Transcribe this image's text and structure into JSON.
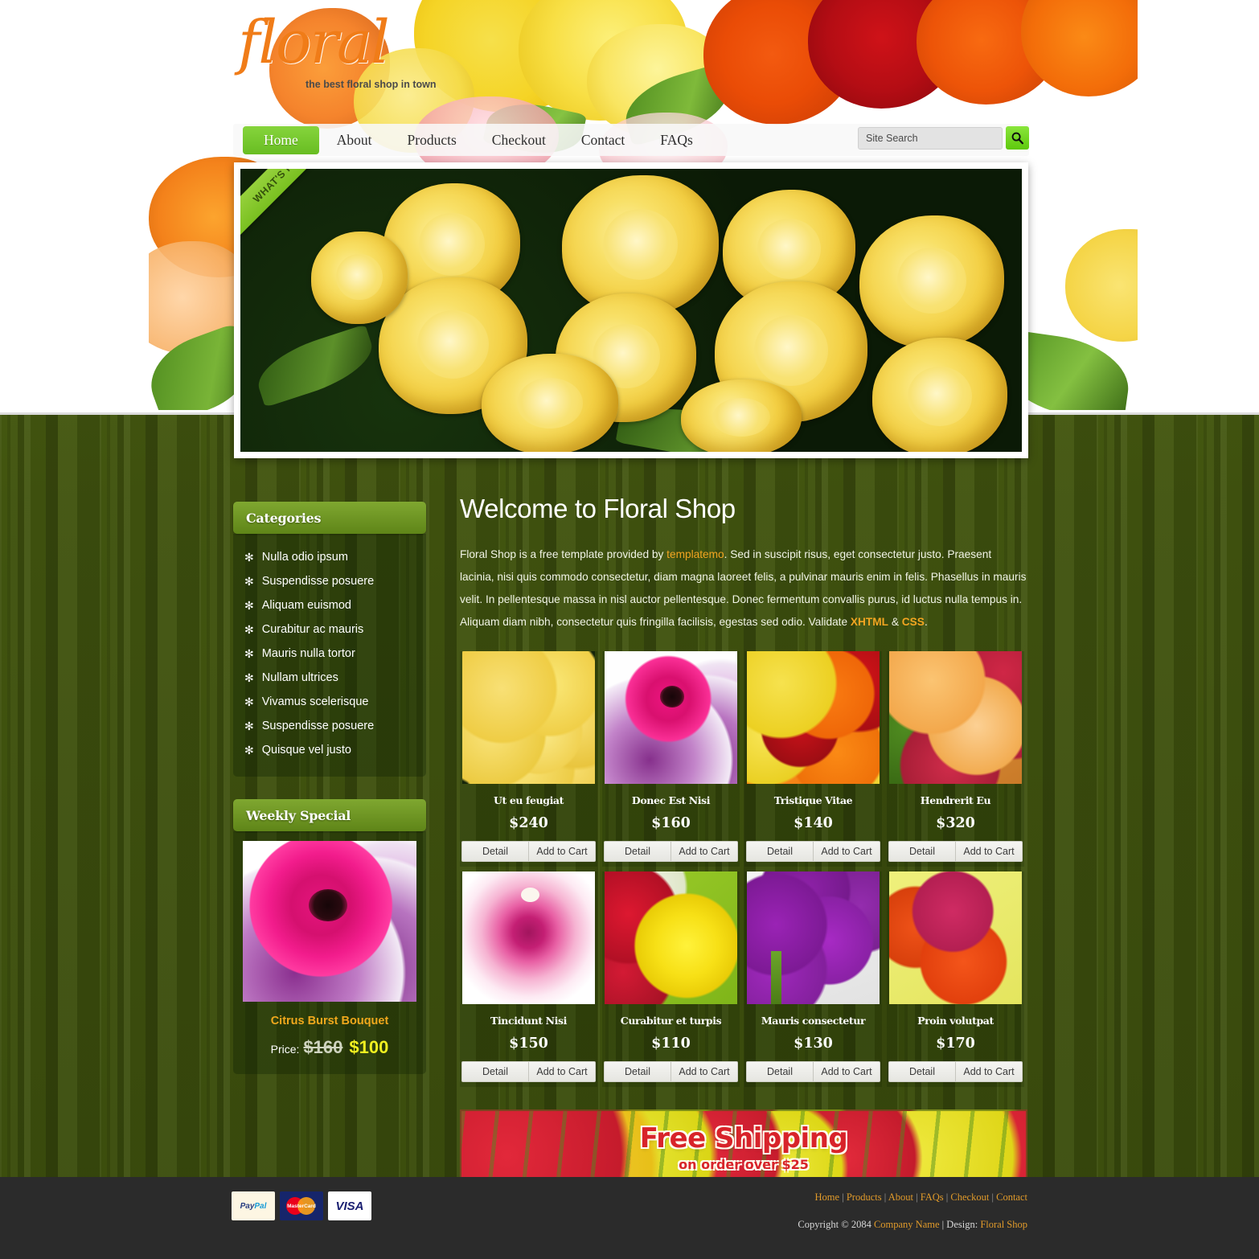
{
  "site": {
    "logo_word": "floral",
    "tagline": "the best floral shop in town"
  },
  "nav": {
    "items": [
      {
        "label": "Home",
        "active": true
      },
      {
        "label": "About",
        "active": false
      },
      {
        "label": "Products",
        "active": false
      },
      {
        "label": "Checkout",
        "active": false
      },
      {
        "label": "Contact",
        "active": false
      },
      {
        "label": "FAQs",
        "active": false
      }
    ],
    "search_placeholder": "Site Search",
    "search_value": "",
    "search_icon": "search-icon"
  },
  "slider": {
    "ribbon_label": "WHAT'S HOT!",
    "image_alt": "yellow roses bouquet"
  },
  "sidebar": {
    "categories": {
      "title": "Categories",
      "bullet": "✻",
      "items": [
        "Nulla odio ipsum",
        "Suspendisse posuere",
        "Aliquam euismod",
        "Curabitur ac mauris",
        "Mauris nulla tortor",
        "Nullam ultrices",
        "Vivamus scelerisque",
        "Suspendisse posuere",
        "Quisque vel justo"
      ]
    },
    "weekly_special": {
      "title": "Weekly Special",
      "product_name": "Citrus Burst Bouquet",
      "price_label": "Price:",
      "old_price": "$160",
      "new_price": "$100"
    }
  },
  "main": {
    "heading": "Welcome to Floral Shop",
    "intro": {
      "part1": "Floral Shop is a free template provided by ",
      "link1": "templatemo",
      "part2": ". Sed in suscipit risus, eget consectetur justo. Praesent lacinia, nisi quis commodo consectetur, diam magna laoreet felis, a pulvinar mauris enim in felis. Phasellus in mauris velit. In pellentesque massa in nisl auctor pellentesque. Donec fermentum convallis purus, id luctus nulla tempus in. Aliquam diam nibh, consectetur quis fringilla facilisis, egestas sed odio. Validate ",
      "link2": "XHTML",
      "part3": " & ",
      "link3": "CSS",
      "part4": "."
    },
    "buttons": {
      "detail": "Detail",
      "add_to_cart": "Add to Cart"
    },
    "products": [
      {
        "name": "Ut eu feugiat",
        "price": "$240"
      },
      {
        "name": "Donec Est Nisi",
        "price": "$160"
      },
      {
        "name": "Tristique Vitae",
        "price": "$140"
      },
      {
        "name": "Hendrerit Eu",
        "price": "$320"
      },
      {
        "name": "Tincidunt Nisi",
        "price": "$150"
      },
      {
        "name": "Curabitur et turpis",
        "price": "$110"
      },
      {
        "name": "Mauris consectetur",
        "price": "$130"
      },
      {
        "name": "Proin volutpat",
        "price": "$170"
      }
    ],
    "banner": {
      "title": "Free Shipping",
      "subtitle": "on order over $25"
    }
  },
  "footer": {
    "payments": [
      "PayPal",
      "MasterCard",
      "VISA"
    ],
    "links": [
      "Home",
      "Products",
      "About",
      "FAQs",
      "Checkout",
      "Contact"
    ],
    "separator": " | ",
    "copyright_prefix": "Copyright © 2084 ",
    "company": "Company Name",
    "design_prefix": " | Design: ",
    "design_link": "Floral Shop"
  },
  "colors": {
    "accent_orange": "#f07c18",
    "nav_active_green": "#74c52c",
    "bg_green": "#46590f",
    "price_yellow": "#f0ef20",
    "footer_bg": "#2b2b2b"
  }
}
